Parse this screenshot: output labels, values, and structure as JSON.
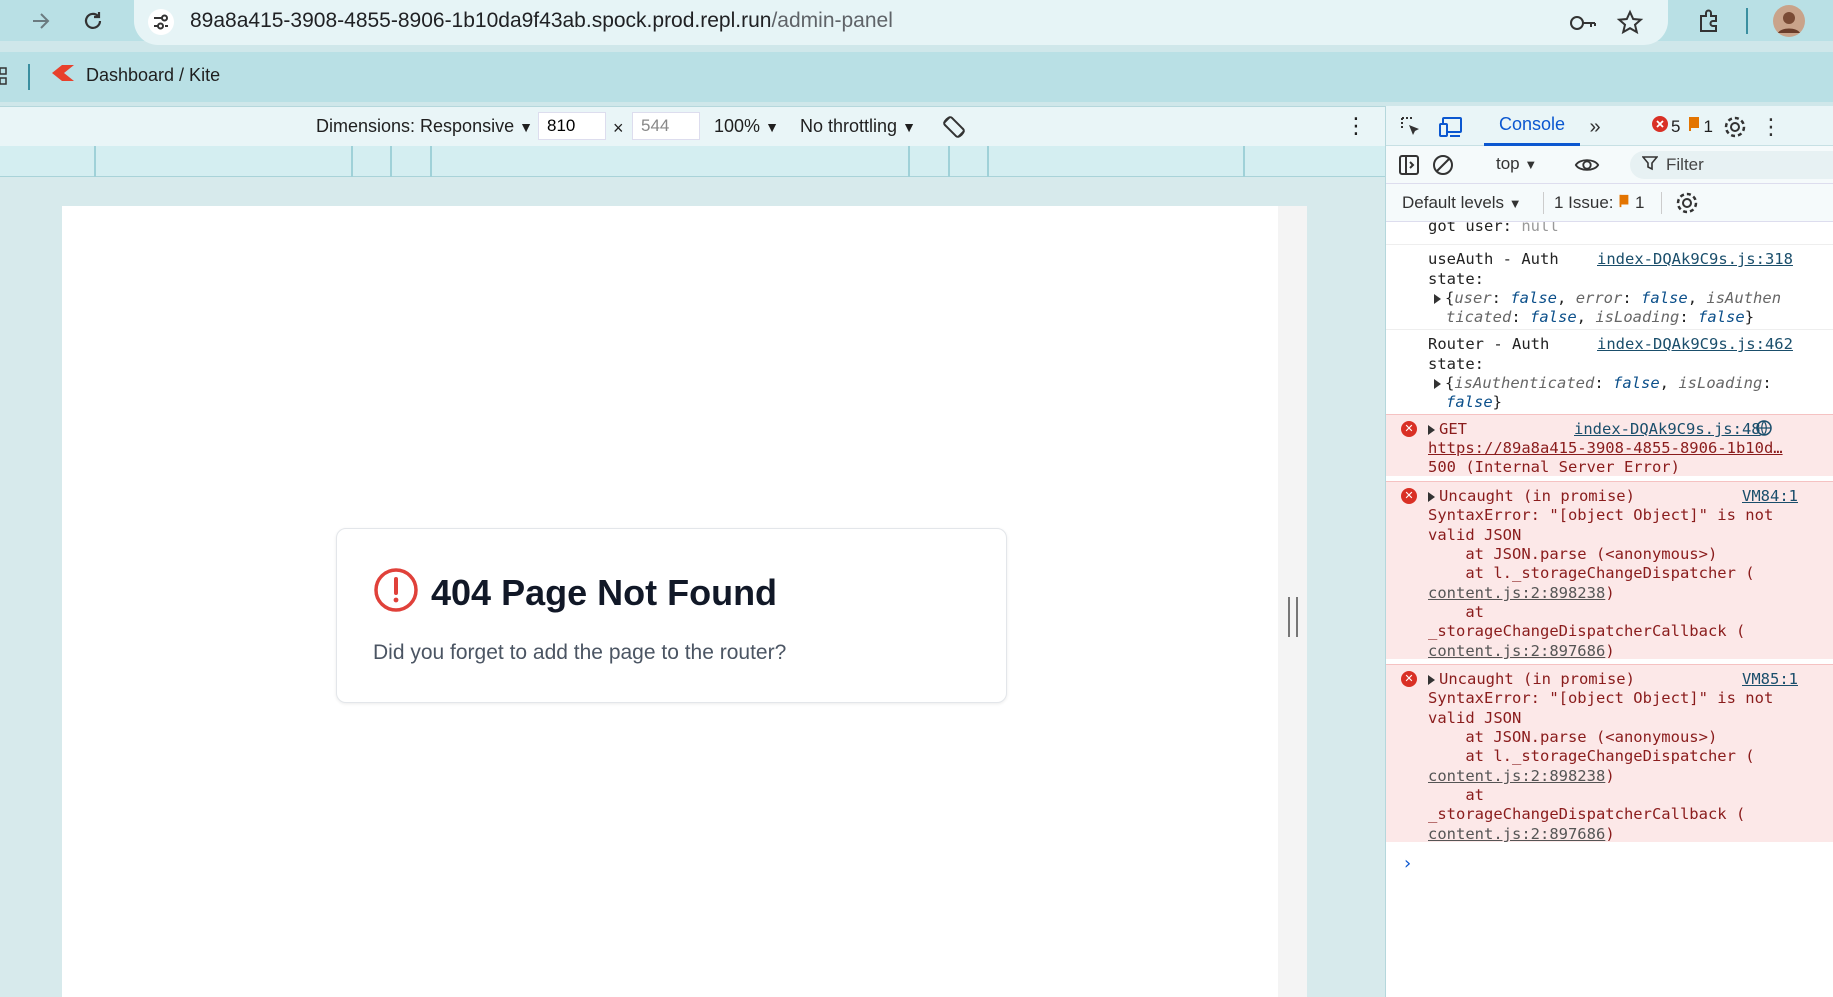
{
  "browser": {
    "url_host": "89a8a415-3908-4855-8906-1b10da9f43ab.spock.prod.repl.run",
    "url_path": "/admin-panel",
    "bookmark_label": "Dashboard / Kite"
  },
  "device_toolbar": {
    "dimensions_label": "Dimensions: Responsive",
    "width_value": "810",
    "height_value": "544",
    "times": "×",
    "zoom": "100%",
    "throttling": "No throttling"
  },
  "page": {
    "title": "404 Page Not Found",
    "description": "Did you forget to add the page to the router?"
  },
  "devtools": {
    "tab_console": "Console",
    "error_count": "5",
    "issue_count": "1",
    "context": "top",
    "filter_placeholder": "Filter",
    "levels": "Default levels",
    "issues_label": "1 Issue:",
    "issues_count": "1"
  },
  "console": {
    "line_got_user": "got user:",
    "line_got_user_val": "null",
    "msg1_line1": "useAuth - Auth",
    "msg1_line2": "state:",
    "msg1_src": "index-DQAk9C9s.js:318",
    "msg2_line1": "Router - Auth",
    "msg2_line2": "state:",
    "msg2_src": "index-DQAk9C9s.js:462",
    "err1_head": "GET",
    "err1_src": "index-DQAk9C9s.js:48",
    "err1_url": "https://89a8a415-3908-4855-8906-1b10d…",
    "err1_status": "500 (Internal Server Error)",
    "err2_head": "Uncaught (in promise)",
    "err2_src": "VM84:1",
    "err3_head": "Uncaught (in promise)",
    "err3_src": "VM85:1",
    "err_l1": "SyntaxError: \"[object Object]\" is not",
    "err_l2": "valid JSON",
    "err_l3": "    at JSON.parse (<anonymous>)",
    "err_l4": "    at l._storageChangeDispatcher (",
    "err_l5": "content.js:2:898238",
    "err_l6": "    at",
    "err_l7": "_storageChangeDispatcherCallback (",
    "err_l8": "content.js:2:897686",
    "close_paren": ")",
    "prompt": "›"
  },
  "colors": {
    "chrome_bg": "#b9e0e5",
    "error_bg": "#fce8e8",
    "accent_blue": "#0b57d0",
    "error_red": "#d93025"
  }
}
